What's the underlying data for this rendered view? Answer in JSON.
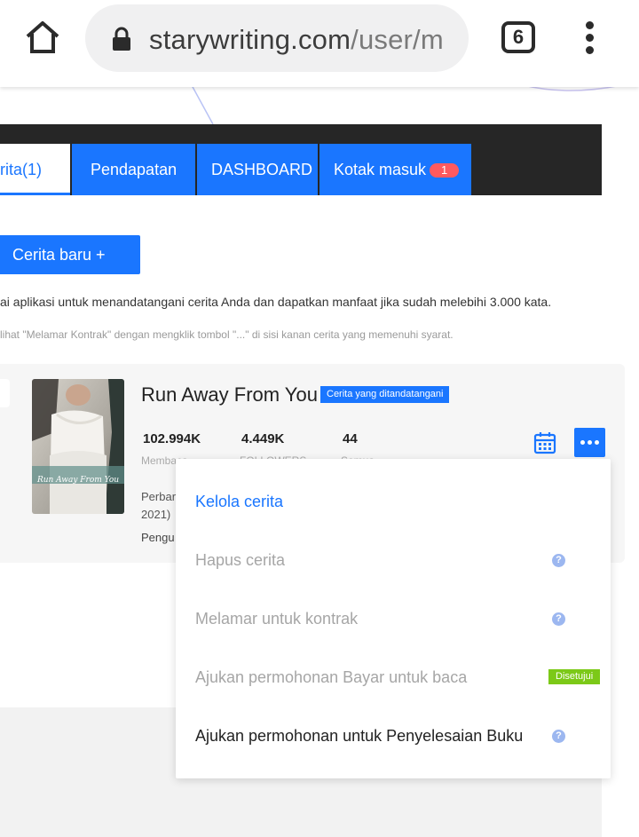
{
  "browser": {
    "url_domain": "starywriting.com",
    "url_path": "/user/m",
    "tab_count": "6",
    "icons": {
      "home": "home-icon",
      "lock": "lock-icon",
      "menu": "kebab-menu-icon"
    }
  },
  "nav": {
    "tabs": [
      {
        "label": "rita(1)"
      },
      {
        "label": "Pendapatan"
      },
      {
        "label": "DASHBOARD"
      },
      {
        "label": "Kotak masuk"
      }
    ],
    "inbox_badge": "1"
  },
  "actions": {
    "new_story_label": "Cerita baru +"
  },
  "info": {
    "line1": "ai aplikasi untuk menandatangani cerita Anda dan dapatkan manfaat jika sudah melebihi 3.000 kata.",
    "line2": "lihat \"Melamar Kontrak\" dengan mengklik tombol \"...\" di sisi kanan cerita yang memenuhi syarat."
  },
  "story": {
    "title": "Run Away From You",
    "status_badge": "Cerita yang ditandatangani",
    "cover_text": "Run Away From You",
    "stats": [
      {
        "value": "102.994K",
        "label": "Membaca"
      },
      {
        "value": "4.449K",
        "label": "FOLLOWERS"
      },
      {
        "value": "44",
        "label": "Semua"
      }
    ],
    "text_updated": "Perbar",
    "text_year": "2021)",
    "text_status": "Pengu"
  },
  "dropdown": {
    "items": [
      {
        "label": "Kelola cerita",
        "state": "active"
      },
      {
        "label": "Hapus cerita",
        "state": "disabled",
        "help": "?"
      },
      {
        "label": "Melamar untuk kontrak",
        "state": "disabled",
        "help": "?"
      },
      {
        "label": "Ajukan permohonan Bayar untuk baca",
        "state": "disabled",
        "badge": "Disetujui"
      },
      {
        "label": "Ajukan permohonan untuk Penyelesaian Buku",
        "state": "enabled",
        "help": "?"
      }
    ]
  },
  "colors": {
    "accent": "#1a76ff",
    "nav_background": "#262626",
    "badge_red": "#ff5a5f",
    "approved_green": "#7cc918",
    "active_menu_text": "#1a76ff",
    "disabled_menu_text": "#a6a6a6"
  }
}
